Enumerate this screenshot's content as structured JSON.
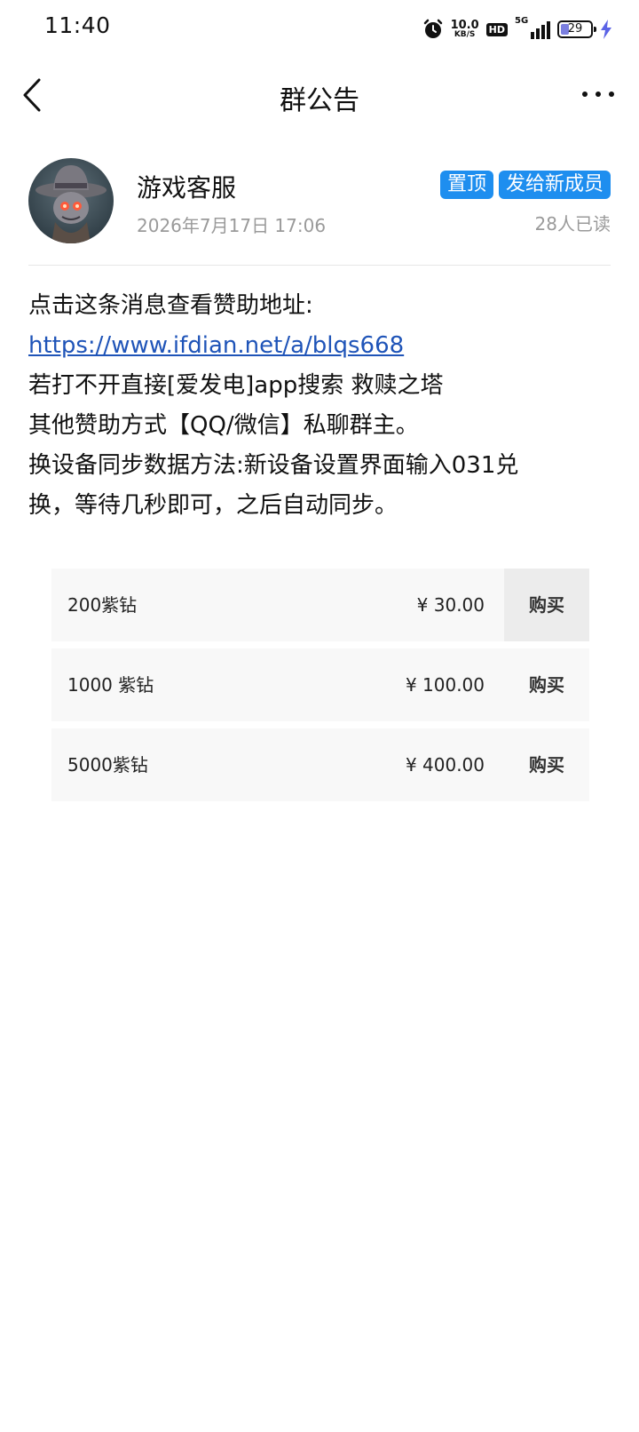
{
  "status_bar": {
    "time": "11:40",
    "net_speed_value": "10.0",
    "net_speed_unit": "KB/S",
    "hd_label": "HD",
    "network_label": "5G",
    "battery_percent": "29",
    "battery_fill_fraction": 0.29,
    "battery_fill_color": "#7b7fe0",
    "icons": [
      "alarm-icon",
      "hd-icon",
      "signal-icon",
      "battery-icon",
      "charging-icon"
    ]
  },
  "nav": {
    "title": "群公告",
    "back_icon": "chevron-left-icon",
    "more_icon": "more-icon"
  },
  "post": {
    "author": "游戏客服",
    "timestamp": "2026年7月17日 17:06",
    "tag_pinned": "置顶",
    "tag_send_new": "发给新成员",
    "read_count": "28人已读",
    "tag_color": "#1e8eef",
    "lines": {
      "l1": "点击这条消息查看赞助地址:",
      "link": "https://www.ifdian.net/a/blqs668",
      "l3": "若打不开直接[爱发电]app搜索 救赎之塔",
      "l4": "其他赞助方式【QQ/微信】私聊群主。",
      "l5a": "换设备同步数据方法:新设备设置界面输入031兑",
      "l5b": "换，等待几秒即可，之后自动同步。"
    },
    "link_color": "#1f54b8"
  },
  "products": [
    {
      "name": "200紫钻",
      "price": "¥ 30.00",
      "buy_label": "购买"
    },
    {
      "name": "1000 紫钻",
      "price": "¥ 100.00",
      "buy_label": "购买"
    },
    {
      "name": "5000紫钻",
      "price": "¥ 400.00",
      "buy_label": "购买"
    }
  ]
}
